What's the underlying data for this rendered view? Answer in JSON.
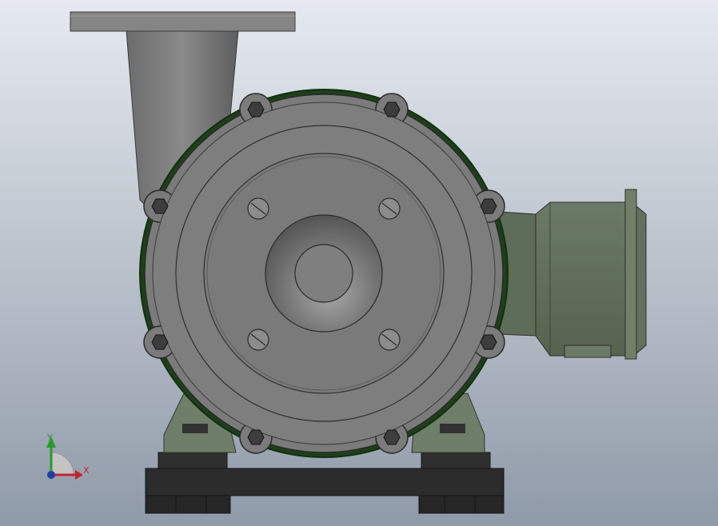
{
  "viewport": {
    "background_top": "#e6eaf0",
    "background_bottom": "#8f9aa8"
  },
  "triad": {
    "x_label": "X",
    "y_label": "Y",
    "x_color": "#c0262c",
    "y_color": "#2a9a2a",
    "z_color": "#1f3fa8"
  },
  "model": {
    "pump_color": "#7a7a7a",
    "motor_color": "#5f6e5a",
    "seal_color": "#234a1e",
    "base_color": "#2a2a2a"
  }
}
